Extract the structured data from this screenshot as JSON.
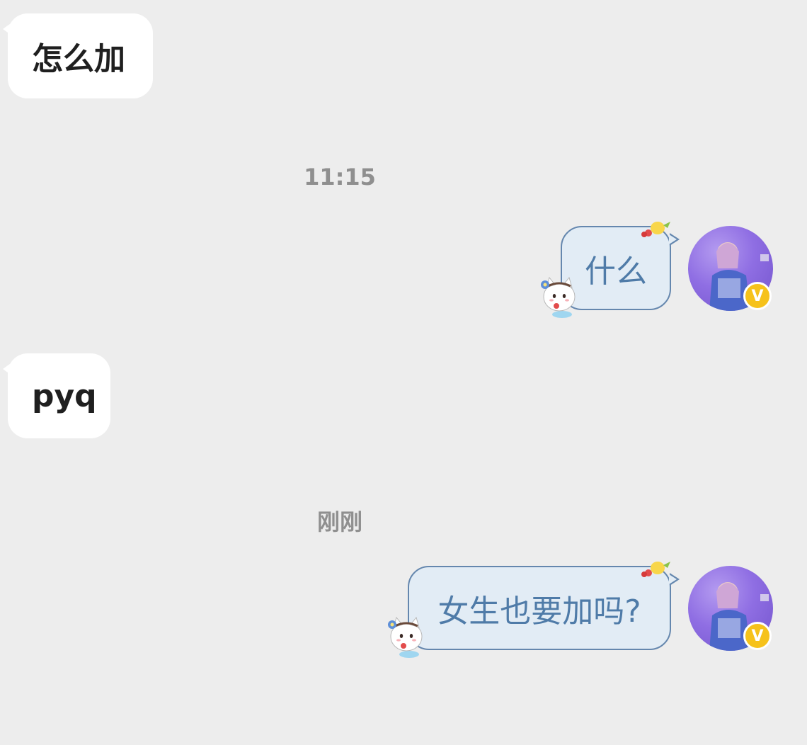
{
  "messages": [
    {
      "side": "left",
      "text": "怎么加"
    },
    {
      "side": "right",
      "text": "什么"
    },
    {
      "side": "left",
      "text": "pyq"
    },
    {
      "side": "right",
      "text": "女生也要加吗?"
    }
  ],
  "timestamps": [
    "11:15",
    "刚刚"
  ],
  "avatar": {
    "icon": "user-photo-avatar",
    "badge_label": "V"
  },
  "colors": {
    "background": "#EDEDED",
    "incoming_bubble": "#FFFFFF",
    "outgoing_bubble": "#E2ECF5",
    "outgoing_border": "#6587AE",
    "outgoing_text": "#4F7BA8",
    "timestamp_text": "#8F8F8F",
    "badge": "#F6C21B"
  }
}
